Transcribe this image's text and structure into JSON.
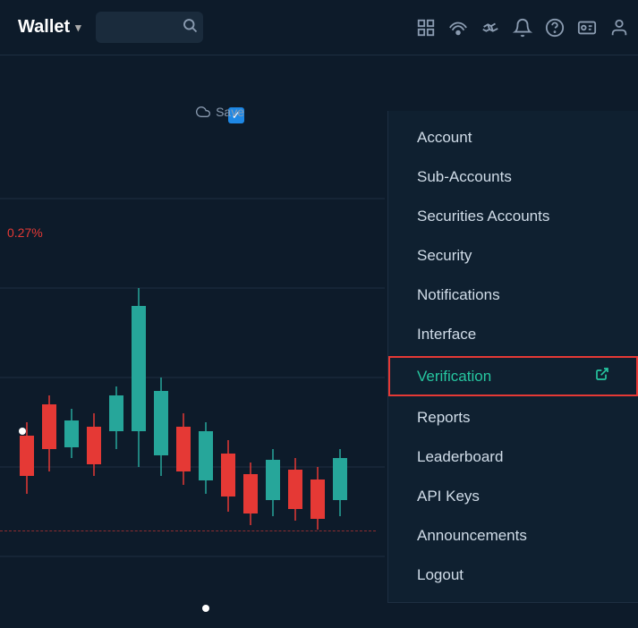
{
  "navbar": {
    "wallet_label": "Wallet",
    "chevron": "∨",
    "search_placeholder": ""
  },
  "nav_icons": [
    {
      "name": "grid-icon",
      "symbol": "⊞"
    },
    {
      "name": "signal-icon",
      "symbol": "((·))"
    },
    {
      "name": "handshake-icon",
      "symbol": "🤝"
    },
    {
      "name": "bell-icon",
      "symbol": "🔔"
    },
    {
      "name": "help-icon",
      "symbol": "?"
    },
    {
      "name": "id-card-icon",
      "symbol": "🪪"
    },
    {
      "name": "user-icon",
      "symbol": "👤"
    }
  ],
  "chart": {
    "pct_label": "0.27%"
  },
  "save_label": "Save",
  "dropdown": {
    "items": [
      {
        "id": "account",
        "label": "Account",
        "highlighted": false,
        "ext_link": false
      },
      {
        "id": "sub-accounts",
        "label": "Sub-Accounts",
        "highlighted": false,
        "ext_link": false
      },
      {
        "id": "securities-accounts",
        "label": "Securities Accounts",
        "highlighted": false,
        "ext_link": false
      },
      {
        "id": "security",
        "label": "Security",
        "highlighted": false,
        "ext_link": false
      },
      {
        "id": "notifications",
        "label": "Notifications",
        "highlighted": false,
        "ext_link": false
      },
      {
        "id": "interface",
        "label": "Interface",
        "highlighted": false,
        "ext_link": false
      },
      {
        "id": "verification",
        "label": "Verification",
        "highlighted": true,
        "ext_link": true
      },
      {
        "id": "reports",
        "label": "Reports",
        "highlighted": false,
        "ext_link": false
      },
      {
        "id": "leaderboard",
        "label": "Leaderboard",
        "highlighted": false,
        "ext_link": false
      },
      {
        "id": "api-keys",
        "label": "API Keys",
        "highlighted": false,
        "ext_link": false
      },
      {
        "id": "announcements",
        "label": "Announcements",
        "highlighted": false,
        "ext_link": false
      },
      {
        "id": "logout",
        "label": "Logout",
        "highlighted": false,
        "ext_link": false
      }
    ]
  }
}
